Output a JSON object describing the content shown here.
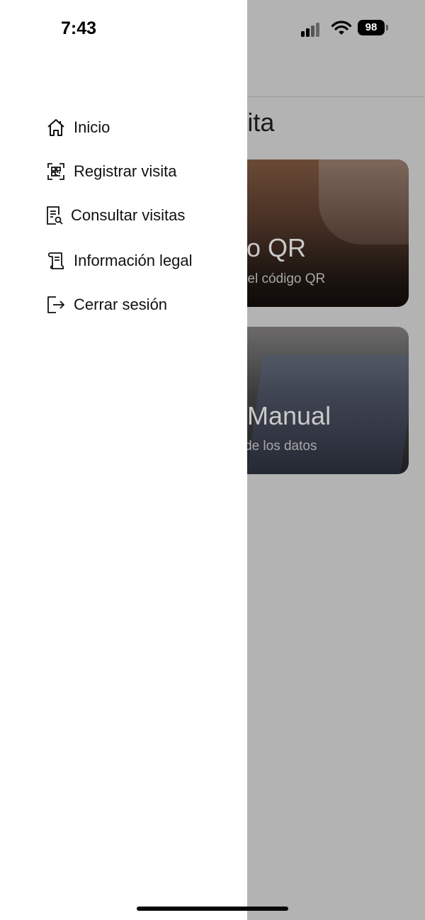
{
  "status_bar": {
    "time": "7:43",
    "battery": "98"
  },
  "background": {
    "page_title": "Visita",
    "cards": [
      {
        "title": "o QR",
        "subtitle": "do el código QR"
      },
      {
        "title": "Manual",
        "subtitle": "de los datos"
      }
    ]
  },
  "drawer": {
    "items": [
      {
        "label": "Inicio",
        "icon": "home-icon"
      },
      {
        "label": "Registrar visita",
        "icon": "qr-scan-icon"
      },
      {
        "label": "Consultar visitas",
        "icon": "document-search-icon"
      },
      {
        "label": "Información legal",
        "icon": "scroll-document-icon"
      },
      {
        "label": "Cerrar sesión",
        "icon": "logout-icon"
      }
    ]
  },
  "colors": {
    "drawer_bg": "#ffffff",
    "overlay": "#b3b3b3",
    "text": "#111111"
  }
}
